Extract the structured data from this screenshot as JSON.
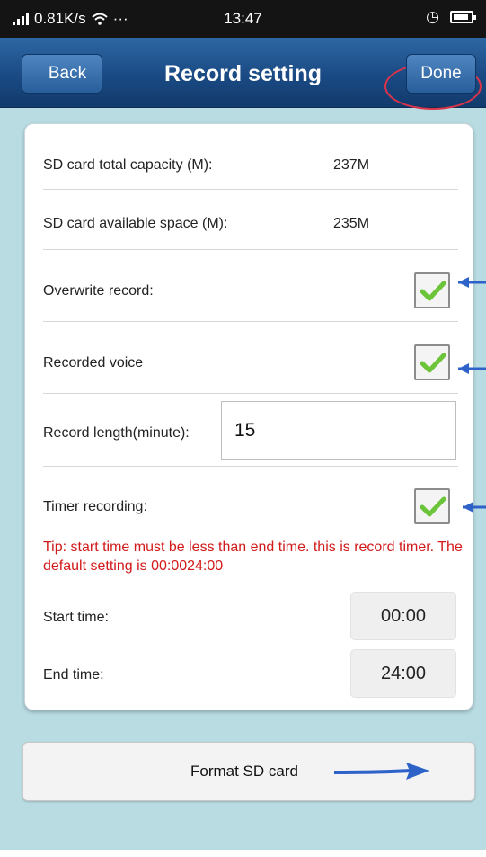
{
  "status_bar": {
    "speed": "0.81K/s",
    "dots": "···",
    "time": "13:47",
    "alarm_icon": "alarm-clock-icon",
    "battery_icon": "battery-icon",
    "wifi_icon": "wifi-icon"
  },
  "nav": {
    "back_label": "Back",
    "title": "Record setting",
    "done_label": "Done"
  },
  "settings": {
    "total_capacity_label": "SD card total capacity (M):",
    "total_capacity_value": "237M",
    "available_space_label": "SD card available space (M):",
    "available_space_value": "235M",
    "overwrite_label": "Overwrite record:",
    "overwrite_checked": true,
    "voice_label": "Recorded voice",
    "voice_checked": true,
    "length_label": "Record length(minute):",
    "length_value": "15",
    "timer_label": "Timer recording:",
    "timer_checked": true,
    "tip": "Tip: start time must be less than end time. this is record timer. The default setting is 00:0024:00",
    "start_label": "Start time:",
    "start_value": "00:00",
    "end_label": "End time:",
    "end_value": "24:00"
  },
  "format_button_label": "Format SD card",
  "colors": {
    "nav_blue": "#1a4a84",
    "background": "#b9dce3",
    "check_green": "#6cc43a",
    "tip_red": "#d21a1a",
    "annotation_blue": "#2d62c9",
    "annotation_ring": "#d9344a"
  }
}
